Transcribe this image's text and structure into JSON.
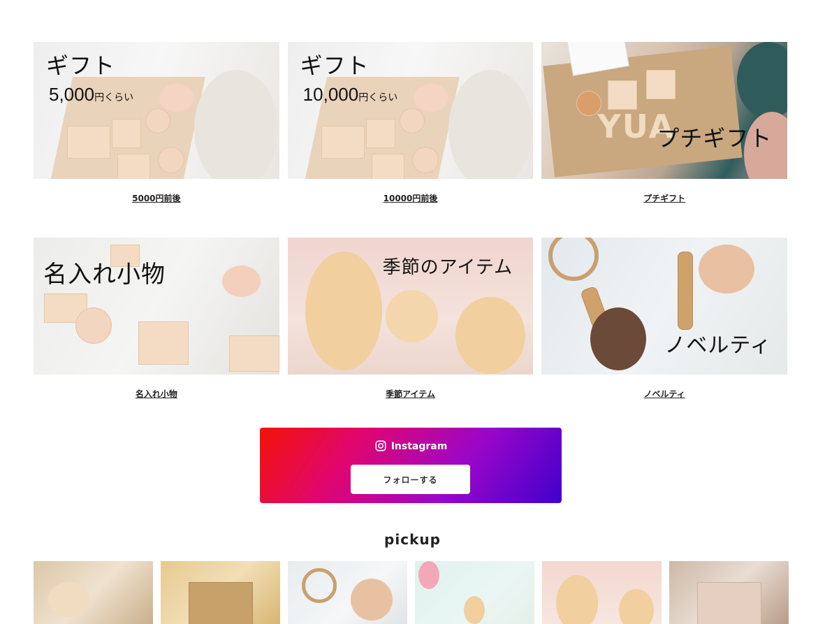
{
  "categories": [
    {
      "overlay_title": "ギフト",
      "overlay_price": "5,000",
      "overlay_unit": "円くらい",
      "caption": "5000円前後"
    },
    {
      "overlay_title": "ギフト",
      "overlay_price": "10,000",
      "overlay_unit": "円くらい",
      "caption": "10000円前後"
    },
    {
      "overlay_title": "プチギフト",
      "overlay_extra": "YUA",
      "caption": "プチギフト"
    },
    {
      "overlay_title": "名入れ小物",
      "caption": "名入れ小物"
    },
    {
      "overlay_title": "季節のアイテム",
      "caption": "季節アイテム"
    },
    {
      "overlay_title": "ノベルティ",
      "caption": "ノベルティ"
    }
  ],
  "instagram": {
    "label": "Instagram",
    "follow_label": "フォローする",
    "gradient_colors": [
      "#f21305",
      "#e1066e",
      "#9b06c9",
      "#4100cb"
    ]
  },
  "pickup": {
    "title": "pickup",
    "thumb_count": 6
  }
}
